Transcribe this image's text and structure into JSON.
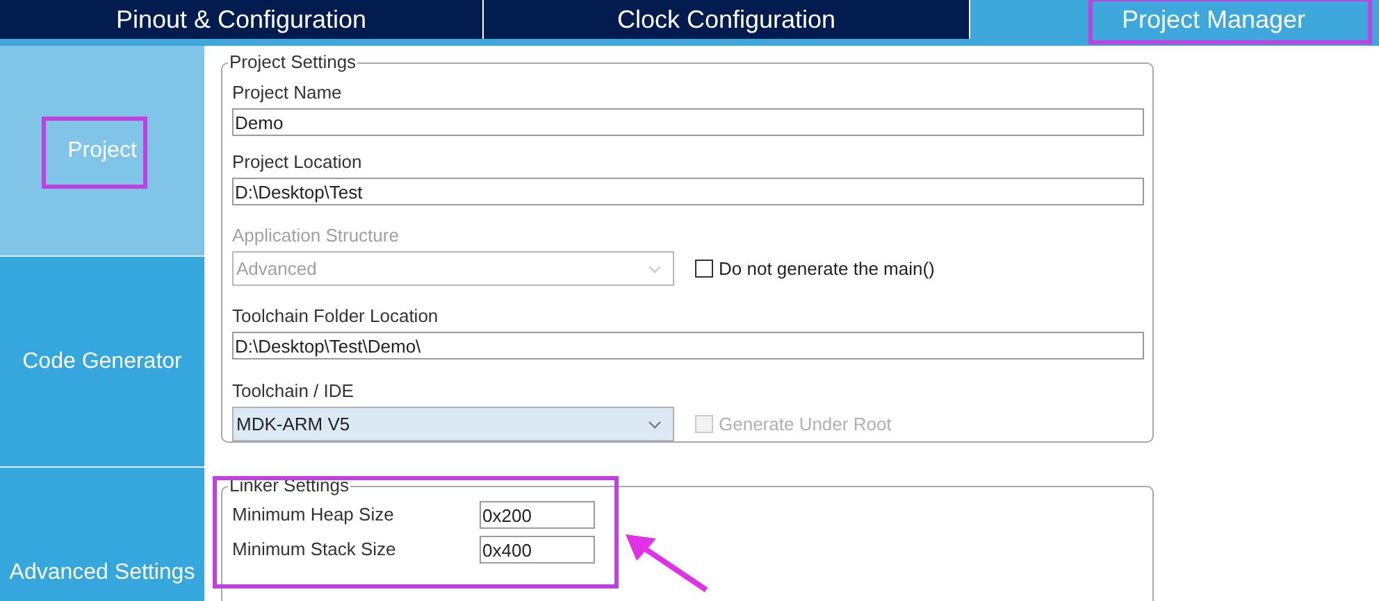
{
  "tabs": [
    {
      "label": "Pinout & Configuration",
      "selected": false
    },
    {
      "label": "Clock Configuration",
      "selected": false
    },
    {
      "label": "Project Manager",
      "selected": true
    }
  ],
  "sidebar": {
    "items": [
      {
        "label": "Project",
        "selected": true
      },
      {
        "label": "Code Generator",
        "selected": false
      },
      {
        "label": "Advanced Settings",
        "selected": false
      }
    ]
  },
  "project_settings": {
    "title": "Project Settings",
    "project_name": {
      "label": "Project Name",
      "value": "Demo"
    },
    "project_location": {
      "label": "Project Location",
      "value": "D:\\Desktop\\Test"
    },
    "application_structure": {
      "label": "Application Structure",
      "value": "Advanced",
      "disabled": true
    },
    "do_not_generate_main": {
      "label": "Do not generate the main()",
      "checked": false,
      "disabled": false
    },
    "toolchain_folder_location": {
      "label": "Toolchain Folder Location",
      "value": "D:\\Desktop\\Test\\Demo\\"
    },
    "toolchain_ide": {
      "label": "Toolchain / IDE",
      "value": "MDK-ARM V5",
      "disabled": false
    },
    "generate_under_root": {
      "label": "Generate Under Root",
      "checked": false,
      "disabled": true
    }
  },
  "linker_settings": {
    "title": "Linker Settings",
    "rows": [
      {
        "label": "Minimum Heap Size",
        "value": "0x200"
      },
      {
        "label": "Minimum Stack Size",
        "value": "0x400"
      }
    ]
  }
}
